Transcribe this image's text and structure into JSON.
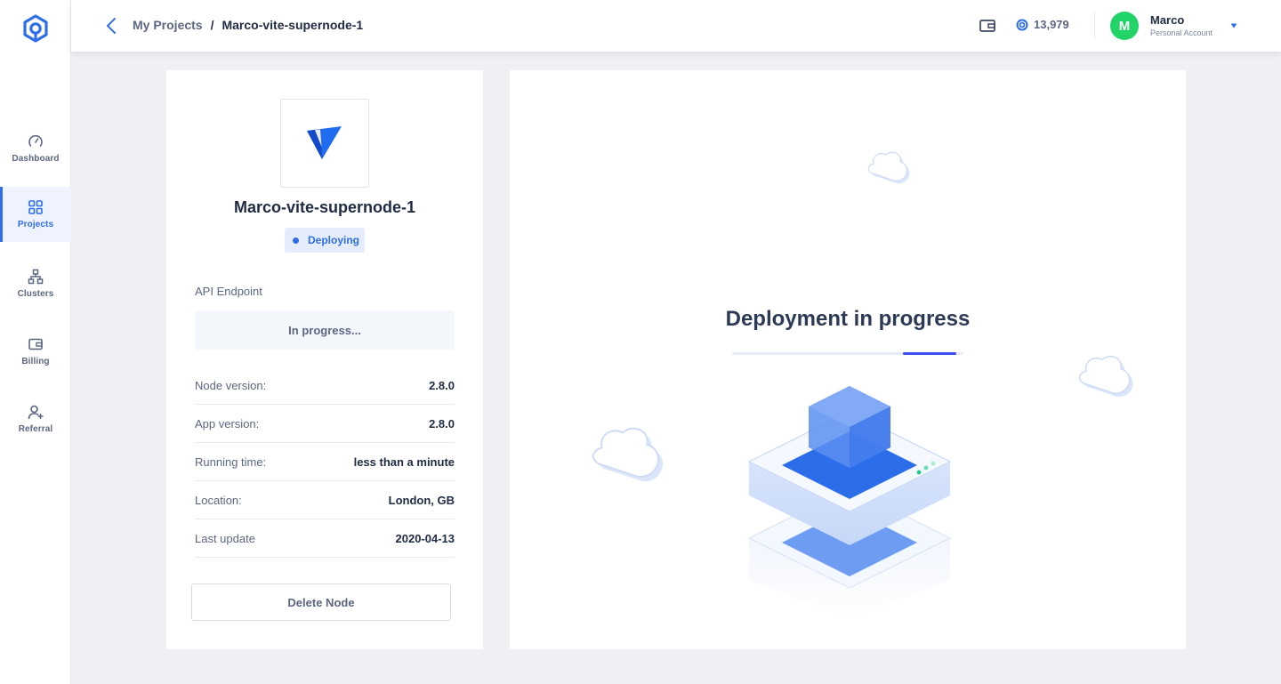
{
  "sidebar": {
    "logo_icon": "logo-icon",
    "items": [
      {
        "label": "Dashboard",
        "icon": "gauge-icon",
        "active": false
      },
      {
        "label": "Projects",
        "icon": "grid-icon",
        "active": true
      },
      {
        "label": "Clusters",
        "icon": "cluster-icon",
        "active": false
      },
      {
        "label": "Billing",
        "icon": "wallet-icon",
        "active": false
      },
      {
        "label": "Referral",
        "icon": "user-plus-icon",
        "active": false
      }
    ]
  },
  "header": {
    "breadcrumb": {
      "parent": "My Projects",
      "separator": "/",
      "current": "Marco-vite-supernode-1"
    },
    "balance": "13,979",
    "account": {
      "initial": "M",
      "name": "Marco",
      "type": "Personal Account"
    }
  },
  "node": {
    "title": "Marco-vite-supernode-1",
    "status": "Deploying",
    "endpoint_label": "API Endpoint",
    "endpoint_value": "In progress...",
    "info": [
      {
        "label": "Node version:",
        "value": "2.8.0"
      },
      {
        "label": "App version:",
        "value": "2.8.0"
      },
      {
        "label": "Running time:",
        "value": "less than a minute"
      },
      {
        "label": "Location:",
        "value": "London, GB"
      },
      {
        "label": "Last update",
        "value": "2020-04-13"
      }
    ],
    "delete_label": "Delete Node"
  },
  "deployment": {
    "title": "Deployment in progress",
    "progress_fraction": 0.23
  },
  "colors": {
    "accent": "#2e6ee8",
    "progress": "#3c4ef0",
    "avatar": "#22d468",
    "background": "#eef0f4"
  }
}
